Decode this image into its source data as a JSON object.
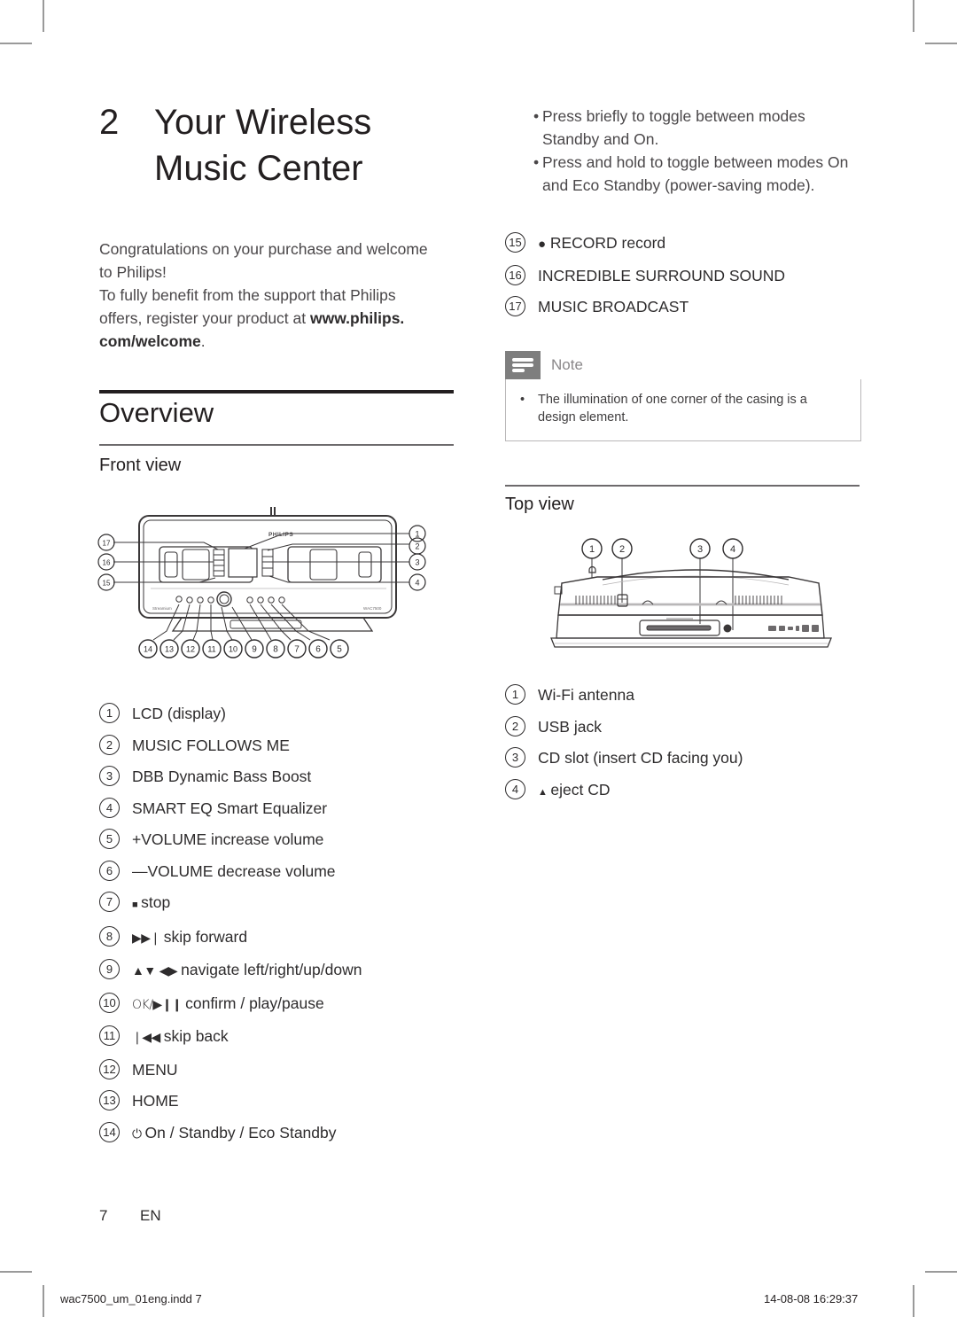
{
  "document": {
    "chapter_number": "2",
    "chapter_title_line1": "Your Wireless",
    "chapter_title_line2": "Music Center",
    "intro_line1": "Congratulations on your purchase and welcome",
    "intro_line2": "to Philips!",
    "intro_line3": "To fully benefit from the support that Philips",
    "intro_line4_prefix": "offers, register your product at ",
    "intro_url_part1": "www.philips.",
    "intro_url_part2": "com/welcome",
    "intro_line4_suffix": "."
  },
  "overview": {
    "heading": "Overview",
    "front_view_heading": "Front view",
    "top_view_heading": "Top view"
  },
  "front_view_items": [
    {
      "num": "1",
      "label": "LCD (display)"
    },
    {
      "num": "2",
      "label": "MUSIC FOLLOWS ME"
    },
    {
      "num": "3",
      "label": "DBB Dynamic Bass Boost"
    },
    {
      "num": "4",
      "label": "SMART EQ Smart Equalizer"
    },
    {
      "num": "5",
      "label": "+VOLUME increase volume"
    },
    {
      "num": "6",
      "label": "—VOLUME decrease volume"
    },
    {
      "num": "7",
      "glyph": "■",
      "label": "stop"
    },
    {
      "num": "8",
      "glyph": "▶▶❘",
      "label": "skip forward"
    },
    {
      "num": "9",
      "glyph": "▲▼ ◀▶",
      "label": "navigate left/right/up/down"
    },
    {
      "num": "10",
      "glyph": "OK/▶❙❙",
      "label": "confirm / play/pause"
    },
    {
      "num": "11",
      "glyph": "❘◀◀",
      "label": "skip back"
    },
    {
      "num": "12",
      "label": "MENU"
    },
    {
      "num": "13",
      "label": "HOME"
    },
    {
      "num": "14",
      "glyph": "⏻",
      "label": "On / Standby / Eco Standby"
    }
  ],
  "power_bullets": [
    "Press briefly to toggle between modes Standby and On.",
    "Press and hold to toggle between modes On and Eco Standby (power-saving mode)."
  ],
  "front_view_items_cont": [
    {
      "num": "15",
      "glyph": "●",
      "label": "RECORD record"
    },
    {
      "num": "16",
      "label": "INCREDIBLE SURROUND SOUND"
    },
    {
      "num": "17",
      "label": "MUSIC BROADCAST"
    }
  ],
  "note": {
    "icon": "note-icon",
    "title": "Note",
    "bullet": "•",
    "text": "The illumination of one corner of the casing is a design element."
  },
  "top_view_items": [
    {
      "num": "1",
      "label": "Wi-Fi antenna"
    },
    {
      "num": "2",
      "label": "USB jack"
    },
    {
      "num": "3",
      "label": "CD slot (insert CD facing you)"
    },
    {
      "num": "4",
      "glyph": "▲",
      "label": "eject CD"
    }
  ],
  "front_view_figure": {
    "brand": "PHILIPS",
    "callouts_right": [
      "1",
      "2",
      "3",
      "4"
    ],
    "callouts_left": [
      "17",
      "16",
      "15"
    ],
    "callouts_bottom": [
      "14",
      "13",
      "12",
      "11",
      "10",
      "9",
      "8",
      "7",
      "6",
      "5"
    ]
  },
  "top_view_figure": {
    "callouts_top": [
      "1",
      "2",
      "3",
      "4"
    ]
  },
  "footer": {
    "page_number": "7",
    "language": "EN",
    "imprint_file": "wac7500_um_01eng.indd   7",
    "imprint_date": "14-08-08   16:29:37"
  },
  "colors": {
    "text": "#2e2c2d",
    "body_text": "#4a4749",
    "rule_dark": "#231f20",
    "rule_light": "#6d6a6c",
    "note_header": "#7e7e7e",
    "note_border": "#b9b7b8",
    "cropmark": "#9a9a9a"
  }
}
